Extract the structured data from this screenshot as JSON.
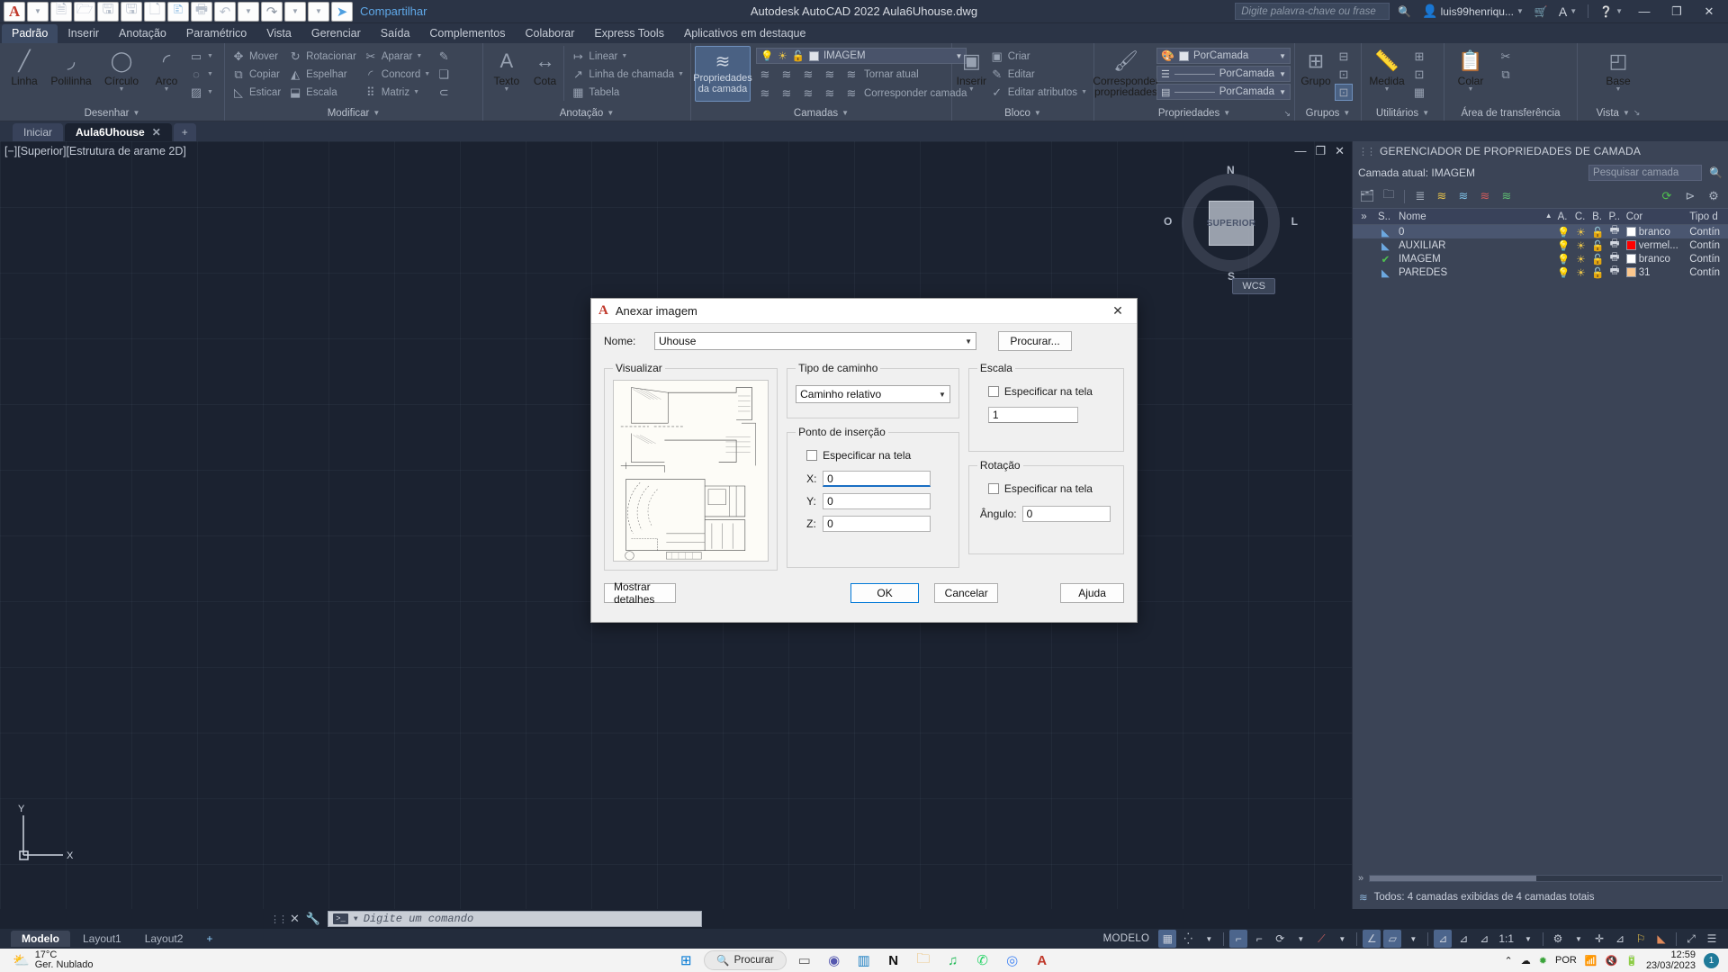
{
  "titlebar": {
    "app_icon": "autocad-a-icon",
    "quick_access": [
      {
        "name": "new-file-icon",
        "glyph": "🗎"
      },
      {
        "name": "open-folder-icon",
        "glyph": "🗁"
      },
      {
        "name": "save-icon",
        "glyph": "🖫"
      },
      {
        "name": "save-as-icon",
        "glyph": "🖫"
      },
      {
        "name": "plot-preview-icon",
        "glyph": "🗋"
      },
      {
        "name": "export-icon",
        "glyph": "🗈"
      },
      {
        "name": "print-icon",
        "glyph": "🖶"
      },
      {
        "name": "undo-icon",
        "glyph": "↶"
      },
      {
        "name": "redo-icon",
        "glyph": "↷"
      }
    ],
    "share_label": "Compartilhar",
    "center_title": "Autodesk AutoCAD 2022   Aula6Uhouse.dwg",
    "search_placeholder": "Digite palavra-chave ou frase",
    "account_name": "luis99henriqu...",
    "window_minimize": "—",
    "window_restore": "❐",
    "window_close": "✕"
  },
  "ribbon_tabs": [
    {
      "label": "Padrão",
      "active": true
    },
    {
      "label": "Inserir",
      "active": false
    },
    {
      "label": "Anotação",
      "active": false
    },
    {
      "label": "Paramétrico",
      "active": false
    },
    {
      "label": "Vista",
      "active": false
    },
    {
      "label": "Gerenciar",
      "active": false
    },
    {
      "label": "Saída",
      "active": false
    },
    {
      "label": "Complementos",
      "active": false
    },
    {
      "label": "Colaborar",
      "active": false
    },
    {
      "label": "Express Tools",
      "active": false
    },
    {
      "label": "Aplicativos em destaque",
      "active": false
    }
  ],
  "ribbon": {
    "desenhar": {
      "title": "Desenhar",
      "big": [
        {
          "label": "Linha",
          "icon": "line-icon",
          "glyph": "╱"
        },
        {
          "label": "Polilinha",
          "icon": "polyline-icon",
          "glyph": "⌐"
        },
        {
          "label": "Círculo",
          "icon": "circle-icon",
          "glyph": "◯"
        },
        {
          "label": "Arco",
          "icon": "arc-icon",
          "glyph": "◜"
        }
      ],
      "small": [
        {
          "icon": "rectangle-icon",
          "glyph": "▭"
        },
        {
          "icon": "ellipse-icon",
          "glyph": "◌"
        },
        {
          "icon": "hatch-icon",
          "glyph": "▨"
        }
      ]
    },
    "modificar": {
      "title": "Modificar",
      "items": [
        {
          "label": "Mover",
          "icon": "move-icon",
          "glyph": "✥"
        },
        {
          "label": "Rotacionar",
          "icon": "rotate-icon",
          "glyph": "↻"
        },
        {
          "label": "Aparar",
          "icon": "trim-icon",
          "glyph": "✂"
        },
        {
          "label": "Copiar",
          "icon": "copy-icon",
          "glyph": "⧉"
        },
        {
          "label": "Espelhar",
          "icon": "mirror-icon",
          "glyph": "◭"
        },
        {
          "label": "Concord",
          "icon": "fillet-icon",
          "glyph": "◜"
        },
        {
          "label": "Esticar",
          "icon": "stretch-icon",
          "glyph": "◺"
        },
        {
          "label": "Escala",
          "icon": "scale-icon",
          "glyph": "⬓"
        },
        {
          "label": "Matriz",
          "icon": "array-icon",
          "glyph": "⠿"
        }
      ],
      "extra_icons": [
        {
          "icon": "erase-icon",
          "glyph": "✎"
        },
        {
          "icon": "explode-icon",
          "glyph": "❏"
        },
        {
          "icon": "offset-icon",
          "glyph": "⊂"
        }
      ]
    },
    "anotacao": {
      "title": "Anotação",
      "big": [
        {
          "label": "Texto",
          "icon": "text-icon",
          "glyph": "A"
        },
        {
          "label": "Cota",
          "icon": "dimension-icon",
          "glyph": "↔"
        }
      ],
      "small": [
        {
          "label": "Linear",
          "icon": "linear-dim-icon",
          "glyph": "↦"
        },
        {
          "label": "Linha de chamada",
          "icon": "leader-icon",
          "glyph": "↗"
        },
        {
          "label": "Tabela",
          "icon": "table-icon",
          "glyph": "▦"
        }
      ]
    },
    "camadas": {
      "title": "Camadas",
      "main_button": "Propriedades da camada",
      "current_layer": "IMAGEM",
      "row1": [
        {
          "label": "Tornar atual",
          "icon": "make-current-icon",
          "glyph": "≋"
        }
      ],
      "row2": [
        {
          "label": "Corresponder camada",
          "icon": "match-layer-icon",
          "glyph": "≋"
        }
      ],
      "state_icons": [
        "bulb-icon",
        "sun-icon",
        "unlock-icon",
        "color-swatch-icon"
      ]
    },
    "bloco": {
      "title": "Bloco",
      "big": {
        "label": "Inserir",
        "icon": "insert-block-icon",
        "glyph": "▣"
      },
      "items": [
        {
          "label": "Criar",
          "icon": "create-block-icon",
          "glyph": "▣"
        },
        {
          "label": "Editar",
          "icon": "edit-block-icon",
          "glyph": "✎"
        },
        {
          "label": "Editar atributos",
          "icon": "edit-attributes-icon",
          "glyph": "✓"
        }
      ]
    },
    "propriedades": {
      "title": "Propriedades",
      "big": {
        "label": "Corresponder propriedades",
        "icon": "match-properties-icon",
        "glyph": "🖌"
      },
      "combos": [
        {
          "name": "color-combo",
          "value": "PorCamada",
          "icon": "color-wheel-icon"
        },
        {
          "name": "linewidth-combo",
          "value": "PorCamada",
          "icon": "lineweight-icon"
        },
        {
          "name": "linetype-combo",
          "value": "PorCamada",
          "icon": "linetype-icon"
        }
      ]
    },
    "grupos": {
      "title": "Grupos",
      "label": "Grupo",
      "icon": "group-icon"
    },
    "utilitarios": {
      "title": "Utilitários",
      "label": "Medida",
      "icon": "measure-icon"
    },
    "area_transferencia": {
      "title": "Área de transferência",
      "label": "Colar",
      "icon": "paste-icon"
    },
    "vista": {
      "title": "Vista",
      "label": "Base",
      "icon": "base-view-icon"
    }
  },
  "file_tabs": [
    {
      "label": "Iniciar",
      "active": false,
      "closable": false
    },
    {
      "label": "Aula6Uhouse",
      "active": true,
      "closable": true
    }
  ],
  "file_tab_add": "+",
  "canvas": {
    "view_label": "[−][Superior][Estrutura de arame 2D]",
    "viewport_controls": [
      "minimize-viewport-icon",
      "restore-viewport-icon",
      "close-viewport-icon"
    ],
    "viewcube": {
      "face": "SUPERIOR",
      "n": "N",
      "s": "S",
      "o": "O",
      "e": "L"
    },
    "wcs_label": "WCS",
    "ucs": {
      "y": "Y",
      "x": "X"
    }
  },
  "layer_manager": {
    "title": "GERENCIADOR DE PROPRIEDADES DE CAMADA",
    "current_layer_label": "Camada atual: IMAGEM",
    "search_placeholder": "Pesquisar camada",
    "toolbar_icons": [
      "new-layer-icon",
      "new-layer-vp-frozen-icon",
      "delete-layer-icon",
      "set-current-icon",
      "new-property-filter-icon",
      "new-group-filter-icon",
      "layer-states-icon",
      "refresh-icon",
      "settings-icon"
    ],
    "columns": [
      "S..",
      "Nome",
      "A.",
      "C.",
      "B.",
      "P..",
      "Cor",
      "Tipo d"
    ],
    "rows": [
      {
        "status": "layer-icon",
        "name": "0",
        "on": "bulb-icon",
        "freeze": "sun-icon",
        "lock": "unlock-icon",
        "plot": "printer-icon",
        "color_swatch": "#ffffff",
        "color": "branco",
        "linetype": "Contín",
        "selected": true
      },
      {
        "status": "layer-icon",
        "name": "AUXILIAR",
        "on": "bulb-icon",
        "freeze": "sun-icon",
        "lock": "unlock-icon",
        "plot": "printer-icon",
        "color_swatch": "#ff0000",
        "color": "vermel...",
        "linetype": "Contín",
        "selected": false
      },
      {
        "status": "current-layer-check",
        "name": "IMAGEM",
        "on": "bulb-icon",
        "freeze": "sun-icon",
        "lock": "unlock-icon",
        "plot": "printer-icon",
        "color_swatch": "#ffffff",
        "color": "branco",
        "linetype": "Contín",
        "selected": false
      },
      {
        "status": "layer-icon",
        "name": "PAREDES",
        "on": "bulb-icon",
        "freeze": "sun-icon",
        "lock": "unlock-icon",
        "plot": "printer-icon",
        "color_swatch": "#fbc78d",
        "color": "31",
        "linetype": "Contín",
        "selected": false
      }
    ],
    "footer": "Todos: 4 camadas exibidas de 4 camadas totais",
    "expand_icon": "chevron-right-icon"
  },
  "command_line": {
    "placeholder": "Digite um comando",
    "close_icon": "close-icon",
    "customize_icon": "wrench-icon",
    "prompt_icon": ">_"
  },
  "layout_tabs": [
    {
      "label": "Modelo",
      "active": true
    },
    {
      "label": "Layout1",
      "active": false
    },
    {
      "label": "Layout2",
      "active": false
    }
  ],
  "layout_tab_add": "+",
  "status_bar": {
    "model_label": "MODELO",
    "scale": "1:1",
    "items": [
      {
        "name": "grid-display-toggle",
        "glyph": "▦",
        "on": true
      },
      {
        "name": "snap-mode-toggle",
        "glyph": "⁞⁞",
        "on": false
      },
      {
        "name": "infer-constraints-toggle",
        "glyph": "⌐",
        "on": true
      },
      {
        "name": "ortho-mode-toggle",
        "glyph": "⌐",
        "on": false
      },
      {
        "name": "polar-tracking-toggle",
        "glyph": "⟳",
        "on": false
      },
      {
        "name": "object-snap-toggle",
        "glyph": "⟋",
        "on": false
      },
      {
        "name": "object-snap-tracking-toggle",
        "glyph": "∠",
        "on": true
      },
      {
        "name": "dynamic-ucs-toggle",
        "glyph": "▱",
        "on": false
      },
      {
        "name": "dynamic-input-toggle",
        "glyph": "⊿",
        "on": true
      },
      {
        "name": "lineweight-toggle",
        "glyph": "⊿",
        "on": false
      },
      {
        "name": "transparency-toggle",
        "glyph": "⊿",
        "on": false
      },
      {
        "name": "annotation-settings",
        "glyph": "⚙",
        "on": false
      },
      {
        "name": "isolate-objects-icon",
        "glyph": "✛",
        "on": false
      },
      {
        "name": "annotation-monitor-icon",
        "glyph": "⚐",
        "on": false
      },
      {
        "name": "workspace-switch-icon",
        "glyph": "⚙",
        "on": false
      },
      {
        "name": "hardware-accel-icon",
        "glyph": "◺",
        "on": false
      },
      {
        "name": "fullscreen-icon",
        "glyph": "⤢",
        "on": false
      },
      {
        "name": "customization-icon",
        "glyph": "☰",
        "on": false
      }
    ]
  },
  "taskbar": {
    "weather_temp": "17°C",
    "weather_desc": "Ger. Nublado",
    "weather_icon": "partly-cloudy-icon",
    "start_icon": "windows-start-icon",
    "search_label": "Procurar",
    "search_icon": "search-icon",
    "apps": [
      {
        "name": "task-view-icon",
        "glyph": "▭",
        "color": "#5a5a5a"
      },
      {
        "name": "teams-icon",
        "glyph": "◉",
        "color": "#5558af"
      },
      {
        "name": "store-icon",
        "glyph": "▥",
        "color": "#1b7ec2"
      },
      {
        "name": "notion-icon",
        "glyph": "N",
        "color": "#111111"
      },
      {
        "name": "file-explorer-icon",
        "glyph": "🗀",
        "color": "#e8a93b"
      },
      {
        "name": "spotify-icon",
        "glyph": "♫",
        "color": "#1db954"
      },
      {
        "name": "whatsapp-icon",
        "glyph": "✆",
        "color": "#25d366"
      },
      {
        "name": "chrome-icon",
        "glyph": "◎",
        "color": "#4285f4"
      },
      {
        "name": "autocad-icon",
        "glyph": "A",
        "color": "#c0392b"
      }
    ],
    "tray": [
      {
        "name": "show-hidden-icons",
        "glyph": "⌃"
      },
      {
        "name": "onedrive-sync-icon",
        "glyph": "☁"
      },
      {
        "name": "antivirus-icon",
        "glyph": "✹"
      }
    ],
    "language": "POR",
    "network_icon": "wifi-icon",
    "volume_icon": "speaker-mute-icon",
    "battery_icon": "battery-charging-icon",
    "time": "12:59",
    "date": "23/03/2023",
    "notification_count": "1"
  },
  "dialog": {
    "title": "Anexar imagem",
    "icon": "autocad-a-icon",
    "close": "✕",
    "name_label": "Nome:",
    "name_value": "Uhouse",
    "browse_button": "Procurar...",
    "preview_legend": "Visualizar",
    "path_type_legend": "Tipo de caminho",
    "path_type_value": "Caminho relativo",
    "insertion_legend": "Ponto de inserção",
    "insertion_specify": "Especificar na tela",
    "x_label": "X:",
    "x_value": "0",
    "y_label": "Y:",
    "y_value": "0",
    "z_label": "Z:",
    "z_value": "0",
    "scale_legend": "Escala",
    "scale_specify": "Especificar na tela",
    "scale_value": "1",
    "rotation_legend": "Rotação",
    "rotation_specify": "Especificar na tela",
    "angle_label": "Ângulo:",
    "angle_value": "0",
    "details_button": "Mostrar detalhes",
    "ok_button": "OK",
    "cancel_button": "Cancelar",
    "help_button": "Ajuda"
  }
}
